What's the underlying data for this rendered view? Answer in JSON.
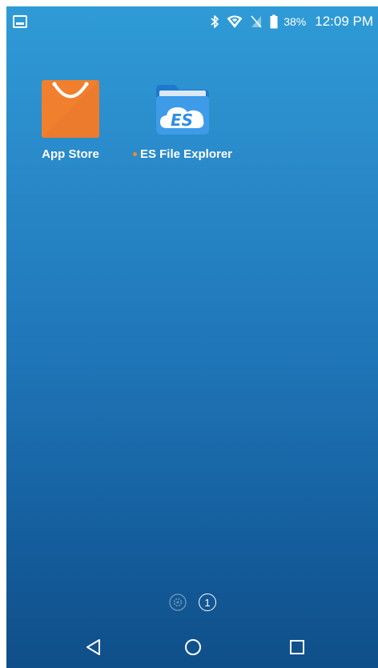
{
  "status_bar": {
    "left_icon": "gallery-notification-icon",
    "icons": [
      "bluetooth-icon",
      "wifi-icon",
      "no-sim-icon",
      "battery-icon"
    ],
    "battery_percent": "38%",
    "time": "12:09 PM"
  },
  "home": {
    "apps": [
      {
        "label": "App Store",
        "icon": "shopping-bag-icon",
        "icon_color": "#f07f2e",
        "has_new_dot": false
      },
      {
        "label": "ES File Explorer",
        "icon": "es-folder-icon",
        "icon_color": "#2f8fe0",
        "has_new_dot": true
      }
    ]
  },
  "page_indicator": {
    "current_page": "1"
  },
  "nav_bar": {
    "buttons": [
      "back-icon",
      "home-icon",
      "recents-icon"
    ]
  },
  "colors": {
    "wallpaper_top": "#2f9bd6",
    "wallpaper_bottom": "#0f4f89",
    "new_dot": "#f08a2c"
  }
}
